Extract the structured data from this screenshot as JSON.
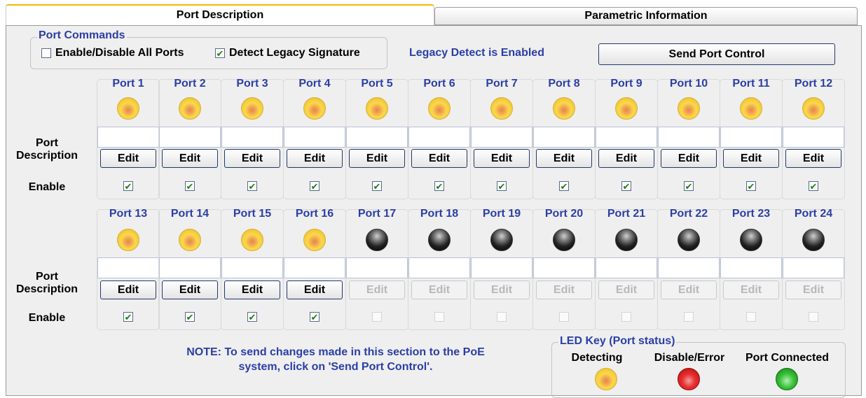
{
  "tabs": [
    {
      "label": "Port Description",
      "active": true
    },
    {
      "label": "Parametric Information",
      "active": false
    }
  ],
  "port_commands": {
    "title": "Port Commands",
    "enable_all": {
      "label": "Enable/Disable All Ports",
      "checked": false
    },
    "detect_legacy": {
      "label": "Detect Legacy Signature",
      "checked": true
    },
    "status": "Legacy Detect is Enabled",
    "send_button": "Send Port Control"
  },
  "row_labels": {
    "port": "Port",
    "description": "Description",
    "enable": "Enable"
  },
  "edit_label": "Edit",
  "ports": [
    {
      "name": "Port 1",
      "led": "yellow",
      "enabled": true,
      "editable": true
    },
    {
      "name": "Port 2",
      "led": "yellow",
      "enabled": true,
      "editable": true
    },
    {
      "name": "Port 3",
      "led": "yellow",
      "enabled": true,
      "editable": true
    },
    {
      "name": "Port 4",
      "led": "yellow",
      "enabled": true,
      "editable": true
    },
    {
      "name": "Port 5",
      "led": "yellow",
      "enabled": true,
      "editable": true
    },
    {
      "name": "Port 6",
      "led": "yellow",
      "enabled": true,
      "editable": true
    },
    {
      "name": "Port 7",
      "led": "yellow",
      "enabled": true,
      "editable": true
    },
    {
      "name": "Port 8",
      "led": "yellow",
      "enabled": true,
      "editable": true
    },
    {
      "name": "Port 9",
      "led": "yellow",
      "enabled": true,
      "editable": true
    },
    {
      "name": "Port 10",
      "led": "yellow",
      "enabled": true,
      "editable": true
    },
    {
      "name": "Port 11",
      "led": "yellow",
      "enabled": true,
      "editable": true
    },
    {
      "name": "Port 12",
      "led": "yellow",
      "enabled": true,
      "editable": true
    },
    {
      "name": "Port 13",
      "led": "yellow",
      "enabled": true,
      "editable": true
    },
    {
      "name": "Port 14",
      "led": "yellow",
      "enabled": true,
      "editable": true
    },
    {
      "name": "Port 15",
      "led": "yellow",
      "enabled": true,
      "editable": true
    },
    {
      "name": "Port 16",
      "led": "yellow",
      "enabled": true,
      "editable": true
    },
    {
      "name": "Port 17",
      "led": "black",
      "enabled": false,
      "editable": false
    },
    {
      "name": "Port 18",
      "led": "black",
      "enabled": false,
      "editable": false
    },
    {
      "name": "Port 19",
      "led": "black",
      "enabled": false,
      "editable": false
    },
    {
      "name": "Port 20",
      "led": "black",
      "enabled": false,
      "editable": false
    },
    {
      "name": "Port 21",
      "led": "black",
      "enabled": false,
      "editable": false
    },
    {
      "name": "Port 22",
      "led": "black",
      "enabled": false,
      "editable": false
    },
    {
      "name": "Port 23",
      "led": "black",
      "enabled": false,
      "editable": false
    },
    {
      "name": "Port 24",
      "led": "black",
      "enabled": false,
      "editable": false
    }
  ],
  "note": {
    "line1": "NOTE: To send changes made in this section to the PoE",
    "line2": "system, click on 'Send Port Control'."
  },
  "led_key": {
    "title": "LED Key (Port status)",
    "items": [
      {
        "label": "Detecting",
        "color": "yellow"
      },
      {
        "label": "Disable/Error",
        "color": "red"
      },
      {
        "label": "Port Connected",
        "color": "green"
      }
    ]
  },
  "colors": {
    "accent_text": "#2b3fa6",
    "panel_bg": "#efefef",
    "active_tab_border": "#f0b800"
  }
}
